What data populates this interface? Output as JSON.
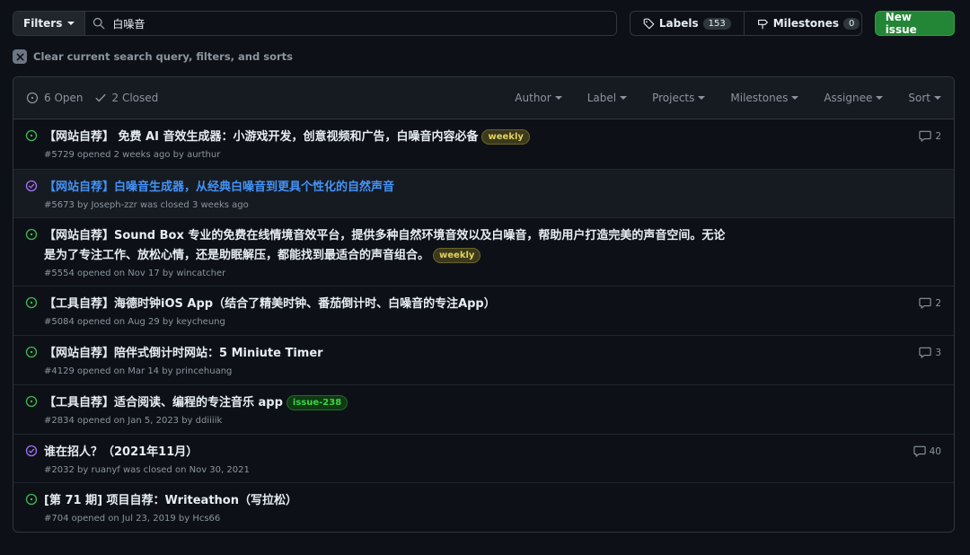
{
  "toolbar": {
    "filters_label": "Filters",
    "search_value": "白噪音",
    "labels_label": "Labels",
    "labels_count": "153",
    "milestones_label": "Milestones",
    "milestones_count": "0",
    "new_issue_label": "New issue"
  },
  "clear_filters": "Clear current search query, filters, and sorts",
  "header": {
    "open_label": "6 Open",
    "closed_label": "2 Closed",
    "menus": [
      "Author",
      "Label",
      "Projects",
      "Milestones",
      "Assignee",
      "Sort"
    ]
  },
  "colors": {
    "open": "#3fb950",
    "closed": "#a371f7",
    "link": "#4493f8"
  },
  "issues": [
    {
      "state": "open",
      "title": "【网站自荐】 免费 AI 音效生成器：小游戏开发，创意视频和广告，白噪音内容必备",
      "label": "weekly",
      "meta": "#5729 opened 2 weeks ago by aurthur",
      "comments": "2"
    },
    {
      "state": "closed",
      "title": "【网站自荐】白噪音生成器，从经典白噪音到更具个性化的自然声音",
      "meta": "#5673 by Joseph-zzr was closed 3 weeks ago"
    },
    {
      "state": "open",
      "title": "【网站自荐】Sound Box 专业的免费在线情境音效平台，提供多种自然环境音效以及白噪音，帮助用户打造完美的声音空间。无论是为了专注工作、放松心情，还是助眠解压，都能找到最适合的声音组合。",
      "label": "weekly",
      "meta": "#5554 opened on Nov 17 by wincatcher"
    },
    {
      "state": "open",
      "title": "【工具自荐】海德时钟iOS App（结合了精美时钟、番茄倒计时、白噪音的专注App）",
      "meta": "#5084 opened on Aug 29 by keycheung",
      "comments": "2"
    },
    {
      "state": "open",
      "title": "【网站自荐】陪伴式倒计时网站：5 Miniute Timer",
      "meta": "#4129 opened on Mar 14 by princehuang",
      "comments": "3"
    },
    {
      "state": "open",
      "title": "【工具自荐】适合阅读、编程的专注音乐 app",
      "label": "issue-238",
      "meta": "#2834 opened on Jan 5, 2023 by ddiiiik"
    },
    {
      "state": "closed",
      "title": "谁在招人？（2021年11月）",
      "meta": "#2032 by ruanyf was closed on Nov 30, 2021",
      "comments": "40"
    },
    {
      "state": "open",
      "title": "[第 71 期] 项目自荐：Writeathon（写拉松）",
      "meta": "#704 opened on Jul 23, 2019 by Hcs66"
    }
  ]
}
